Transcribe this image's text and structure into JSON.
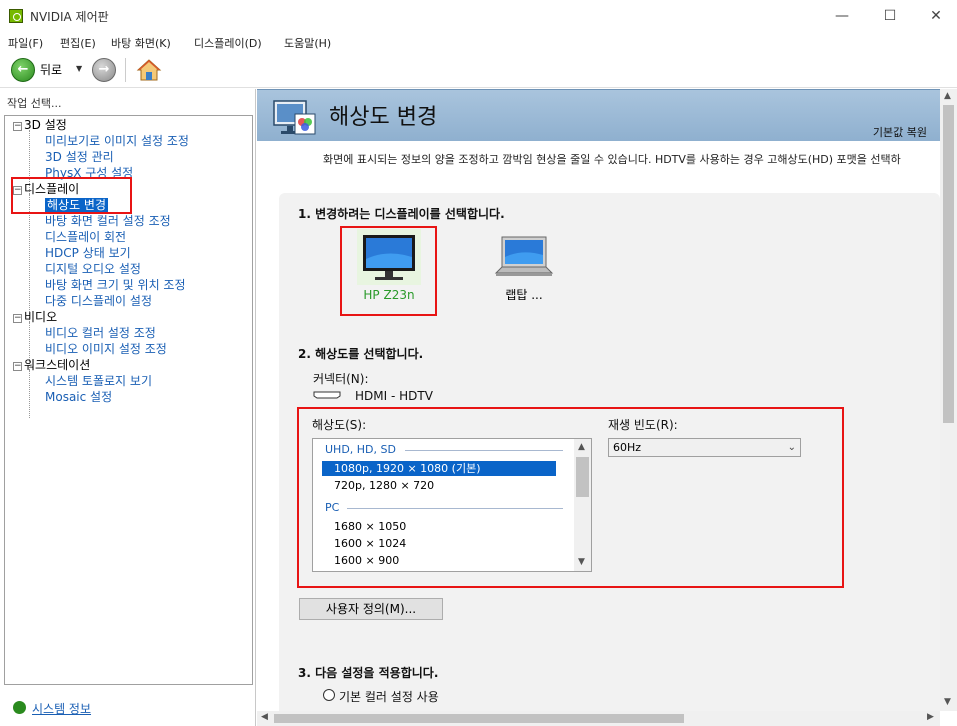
{
  "window": {
    "title": "NVIDIA 제어판",
    "minimize": "—",
    "maximize": "☐",
    "close": "✕"
  },
  "menu": [
    "파일(F)",
    "편집(E)",
    "바탕 화면(K)",
    "디스플레이(D)",
    "도움말(H)"
  ],
  "toolbar": {
    "back_label": "뒤로"
  },
  "left": {
    "header": "작업 선택...",
    "tree": [
      {
        "label": "3D 설정",
        "type": "category"
      },
      {
        "label": "미리보기로 이미지 설정 조정",
        "type": "item"
      },
      {
        "label": "3D 설정 관리",
        "type": "item"
      },
      {
        "label": "PhysX 구성 설정",
        "type": "item"
      },
      {
        "label": "디스플레이",
        "type": "category"
      },
      {
        "label": "해상도 변경",
        "type": "item",
        "selected": true
      },
      {
        "label": "바탕 화면 컬러 설정 조정",
        "type": "item"
      },
      {
        "label": "디스플레이 회전",
        "type": "item"
      },
      {
        "label": "HDCP 상태 보기",
        "type": "item"
      },
      {
        "label": "디지털 오디오 설정",
        "type": "item"
      },
      {
        "label": "바탕 화면 크기 및 위치 조정",
        "type": "item"
      },
      {
        "label": "다중 디스플레이 설정",
        "type": "item"
      },
      {
        "label": "비디오",
        "type": "category"
      },
      {
        "label": "비디오 컬러 설정 조정",
        "type": "item"
      },
      {
        "label": "비디오 이미지 설정 조정",
        "type": "item"
      },
      {
        "label": "워크스테이션",
        "type": "category"
      },
      {
        "label": "시스템 토폴로지 보기",
        "type": "item"
      },
      {
        "label": "Mosaic 설정",
        "type": "item"
      }
    ],
    "system_info": "시스템 정보"
  },
  "main": {
    "title": "해상도 변경",
    "reset": "기본값 복원",
    "description": "화면에 표시되는 정보의 양을 조정하고 깜박임 현상을 줄일 수 있습니다. HDTV를 사용하는 경우 고해상도(HD) 포맷을 선택하",
    "step1": "1. 변경하려는 디스플레이를 선택합니다.",
    "displays": [
      {
        "name": "HP Z23n",
        "selected": true
      },
      {
        "name": "랩탑 ...",
        "selected": false
      }
    ],
    "step2": "2. 해상도를 선택합니다.",
    "connector_label": "커넥터(N):",
    "connector_value": "HDMI - HDTV",
    "resolution_label": "해상도(S):",
    "resolution_groups": [
      {
        "name": "UHD, HD, SD",
        "items": [
          "1080p, 1920 × 1080 (기본)",
          "720p, 1280 × 720"
        ]
      },
      {
        "name": "PC",
        "items": [
          "1680 × 1050",
          "1600 × 1024",
          "1600 × 900"
        ]
      }
    ],
    "selected_resolution": "1080p, 1920 × 1080 (기본)",
    "refresh_label": "재생 빈도(R):",
    "refresh_value": "60Hz",
    "custom_button": "사용자 정의(M)...",
    "step3": "3. 다음 설정을 적용합니다.",
    "radio_default_color": "기본 컬러 설정 사용"
  },
  "colors": {
    "highlight": "#e81414",
    "selection": "#0a64c8",
    "banner": "#9fbcd8",
    "link": "#1a5fb4",
    "nvidia_green": "#76b900"
  }
}
